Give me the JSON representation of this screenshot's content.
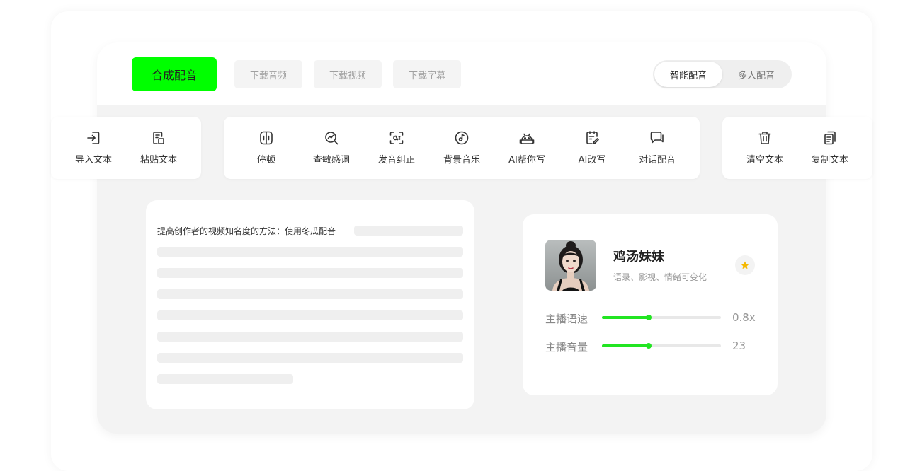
{
  "header": {
    "primary_button": "合成配音",
    "download_audio": "下载音频",
    "download_video": "下载视频",
    "download_subtitle": "下载字幕",
    "mode_toggle": {
      "active": "智能配音",
      "inactive": "多人配音"
    }
  },
  "toolbar_left": [
    {
      "label": "导入文本",
      "icon": "import-icon"
    },
    {
      "label": "粘贴文本",
      "icon": "paste-icon"
    }
  ],
  "toolbar_center": [
    {
      "label": "停顿",
      "icon": "pause-icon"
    },
    {
      "label": "查敏感词",
      "icon": "search-chart-icon"
    },
    {
      "label": "发音纠正",
      "icon": "pronunciation-icon"
    },
    {
      "label": "背景音乐",
      "icon": "music-icon"
    },
    {
      "label": "AI帮你写",
      "icon": "robot-icon"
    },
    {
      "label": "AI改写",
      "icon": "rewrite-icon"
    },
    {
      "label": "对话配音",
      "icon": "dialog-icon"
    }
  ],
  "toolbar_right": [
    {
      "label": "清空文本",
      "icon": "trash-icon"
    },
    {
      "label": "复制文本",
      "icon": "copy-icon"
    }
  ],
  "editor": {
    "first_line": "提高创作者的视频知名度的方法：使用冬瓜配音"
  },
  "voice_card": {
    "name": "鸡汤妹妹",
    "description": "语录、影视、情绪可变化",
    "favorite_icon": "star-icon",
    "speed": {
      "label": "主播语速",
      "value": "0.8x",
      "level": 0.39
    },
    "volume": {
      "label": "主播音量",
      "value": "23",
      "level": 0.39
    }
  },
  "colors": {
    "accent": "#00ff00",
    "slider": "#22e522",
    "star": "#f5b800"
  }
}
